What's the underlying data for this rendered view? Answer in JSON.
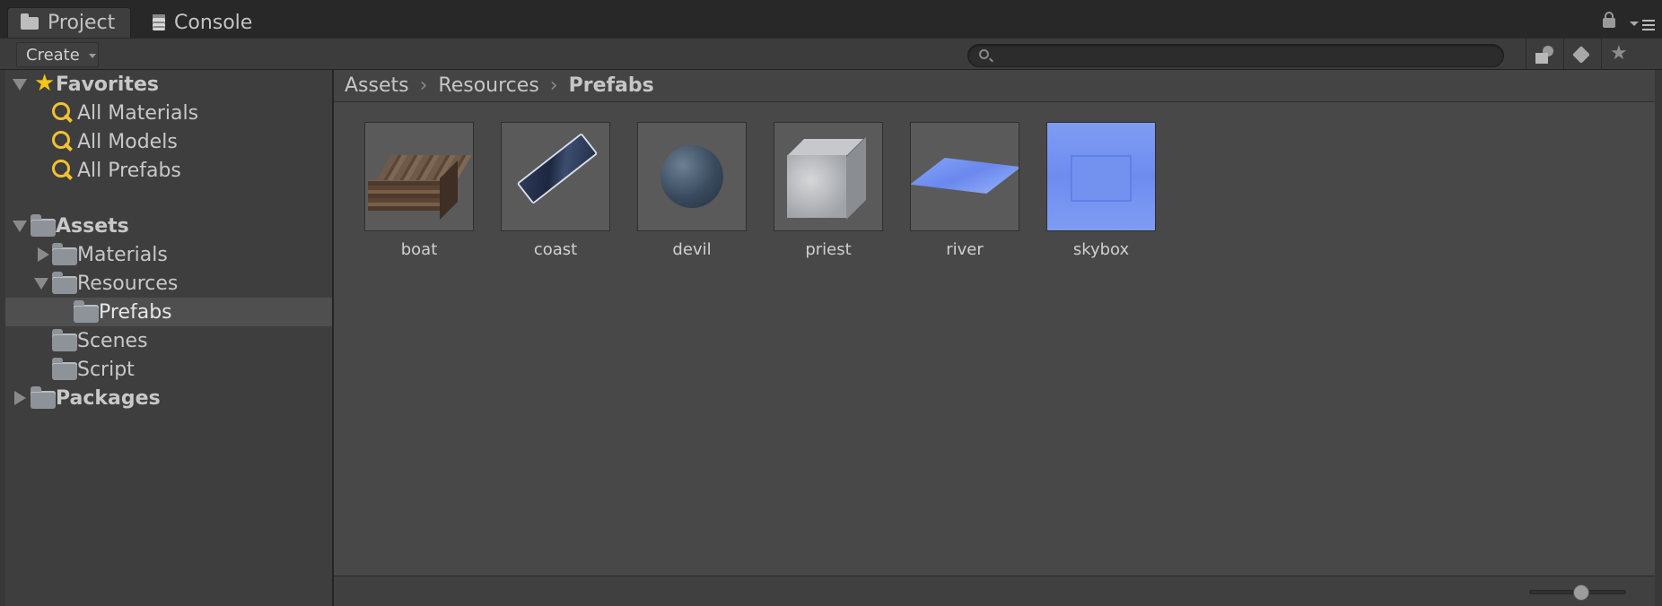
{
  "tabs": [
    {
      "label": "Project",
      "active": true,
      "icon": "folder-icon"
    },
    {
      "label": "Console",
      "active": false,
      "icon": "console-icon"
    }
  ],
  "toolbar": {
    "create_label": "Create",
    "search": {
      "value": "",
      "placeholder": ""
    },
    "icons": [
      "search-by-type-icon",
      "search-by-label-icon",
      "save-search-star-icon"
    ]
  },
  "sidebar": {
    "favorites": {
      "label": "Favorites",
      "expanded": true,
      "items": [
        {
          "label": "All Materials"
        },
        {
          "label": "All Models"
        },
        {
          "label": "All Prefabs"
        }
      ]
    },
    "assets": {
      "label": "Assets",
      "expanded": true,
      "children": [
        {
          "label": "Materials",
          "expanded": false,
          "has_children": true
        },
        {
          "label": "Resources",
          "expanded": true,
          "has_children": true
        },
        {
          "label": "Prefabs",
          "selected": true
        },
        {
          "label": "Scenes"
        },
        {
          "label": "Script"
        }
      ]
    },
    "packages": {
      "label": "Packages",
      "expanded": false
    }
  },
  "breadcrumb": [
    "Assets",
    "Resources",
    "Prefabs"
  ],
  "assets": [
    {
      "name": "boat",
      "icon": "boat-prefab-thumbnail"
    },
    {
      "name": "coast",
      "icon": "coast-prefab-thumbnail"
    },
    {
      "name": "devil",
      "icon": "devil-prefab-thumbnail"
    },
    {
      "name": "priest",
      "icon": "priest-prefab-thumbnail"
    },
    {
      "name": "river",
      "icon": "river-prefab-thumbnail"
    },
    {
      "name": "skybox",
      "icon": "skybox-material-thumbnail"
    }
  ],
  "zoom": {
    "value": 0.55
  },
  "colors": {
    "background": "#383838",
    "panel": "#3e3e3e",
    "content": "#484848",
    "selection": "#4f4f4f",
    "favorite_accent": "#f2c230"
  }
}
